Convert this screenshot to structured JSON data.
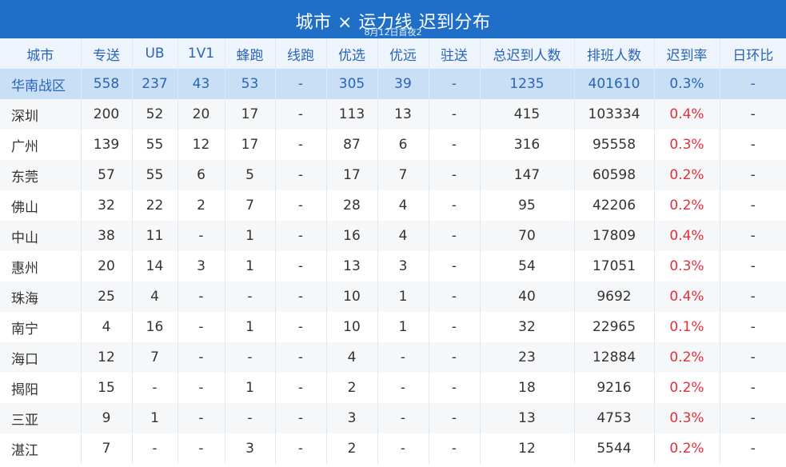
{
  "title": "城市 × 运力线 迟到分布",
  "subtitle": "8月12日首夜2",
  "columns": [
    "城市",
    "专送",
    "UB",
    "1V1",
    "蜂跑",
    "线跑",
    "优选",
    "优远",
    "驻送",
    "总迟到人数",
    "排班人数",
    "迟到率",
    "日环比"
  ],
  "rows": [
    [
      "华南战区",
      "558",
      "237",
      "43",
      "53",
      "-",
      "305",
      "39",
      "-",
      "1235",
      "401610",
      "0.3%",
      "-"
    ],
    [
      "深圳",
      "200",
      "52",
      "20",
      "17",
      "-",
      "113",
      "13",
      "-",
      "415",
      "103334",
      "0.4%",
      "-"
    ],
    [
      "广州",
      "139",
      "55",
      "12",
      "17",
      "-",
      "87",
      "6",
      "-",
      "316",
      "95558",
      "0.3%",
      "-"
    ],
    [
      "东莞",
      "57",
      "55",
      "6",
      "5",
      "-",
      "17",
      "7",
      "-",
      "147",
      "60598",
      "0.2%",
      "-"
    ],
    [
      "佛山",
      "32",
      "22",
      "2",
      "7",
      "-",
      "28",
      "4",
      "-",
      "95",
      "42206",
      "0.2%",
      "-"
    ],
    [
      "中山",
      "38",
      "11",
      "-",
      "1",
      "-",
      "16",
      "4",
      "-",
      "70",
      "17809",
      "0.4%",
      "-"
    ],
    [
      "惠州",
      "20",
      "14",
      "3",
      "1",
      "-",
      "13",
      "3",
      "-",
      "54",
      "17051",
      "0.3%",
      "-"
    ],
    [
      "珠海",
      "25",
      "4",
      "-",
      "-",
      "-",
      "10",
      "1",
      "-",
      "40",
      "9692",
      "0.4%",
      "-"
    ],
    [
      "南宁",
      "4",
      "16",
      "-",
      "1",
      "-",
      "10",
      "1",
      "-",
      "32",
      "22965",
      "0.1%",
      "-"
    ],
    [
      "海口",
      "12",
      "7",
      "-",
      "-",
      "-",
      "4",
      "-",
      "-",
      "23",
      "12884",
      "0.2%",
      "-"
    ],
    [
      "揭阳",
      "15",
      "-",
      "-",
      "1",
      "-",
      "2",
      "-",
      "-",
      "18",
      "9216",
      "0.2%",
      "-"
    ],
    [
      "三亚",
      "9",
      "1",
      "-",
      "-",
      "-",
      "3",
      "-",
      "-",
      "13",
      "4753",
      "0.3%",
      "-"
    ],
    [
      "湛江",
      "7",
      "-",
      "-",
      "3",
      "-",
      "2",
      "-",
      "-",
      "12",
      "5544",
      "0.2%",
      "-"
    ]
  ],
  "colors": {
    "header_bar": "#1f6fc9",
    "header_text": "#2a64b8",
    "summary_row": "#c8dff6",
    "rate_text": "#e0313a"
  }
}
